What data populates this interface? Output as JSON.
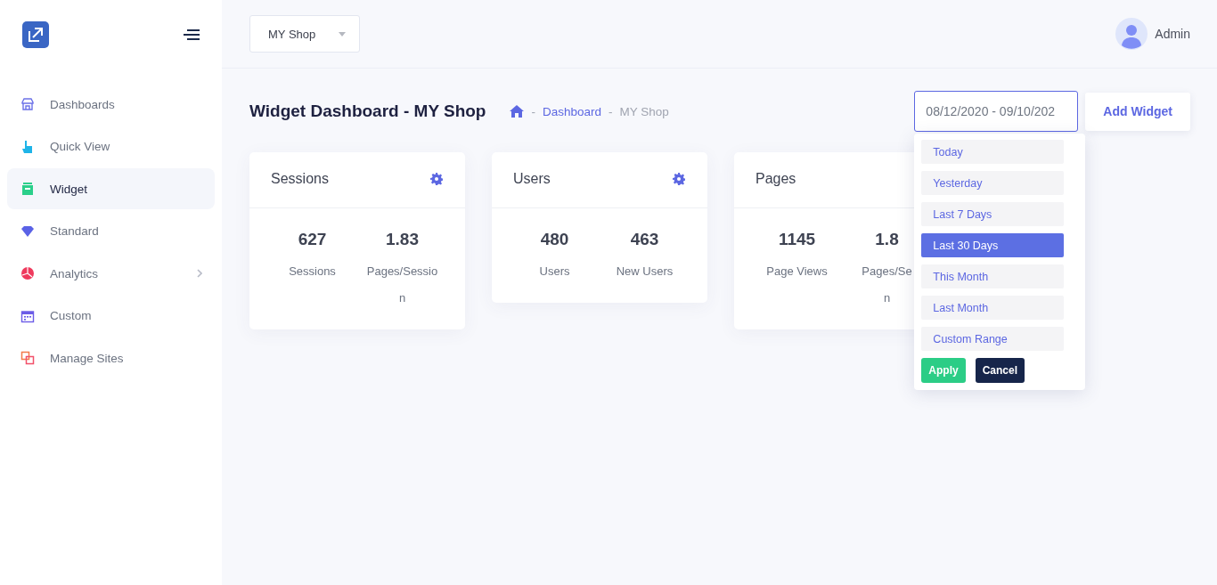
{
  "header": {
    "shop_select": "MY Shop",
    "user": "Admin"
  },
  "sidebar": {
    "items": [
      {
        "label": "Dashboards",
        "kind": "store",
        "selected": false
      },
      {
        "label": "Quick View",
        "kind": "hand",
        "selected": false
      },
      {
        "label": "Widget",
        "kind": "box",
        "selected": true
      },
      {
        "label": "Standard",
        "kind": "gem",
        "selected": false
      },
      {
        "label": "Analytics",
        "kind": "pie",
        "selected": false,
        "has_children": true
      },
      {
        "label": "Custom",
        "kind": "calendar",
        "selected": false
      },
      {
        "label": "Manage Sites",
        "kind": "squares",
        "selected": false
      }
    ]
  },
  "page": {
    "title": "Widget Dashboard - MY Shop",
    "breadcrumb": [
      {
        "separator": "-",
        "label": "Dashboard"
      },
      {
        "separator": "-",
        "label": "MY Shop"
      }
    ]
  },
  "date_range": {
    "value": "08/12/2020 - 09/10/202",
    "options": [
      {
        "label": "Today",
        "selected": false
      },
      {
        "label": "Yesterday",
        "selected": false
      },
      {
        "label": "Last 7 Days",
        "selected": false
      },
      {
        "label": "Last 30 Days",
        "selected": true
      },
      {
        "label": "This Month",
        "selected": false
      },
      {
        "label": "Last Month",
        "selected": false
      },
      {
        "label": "Custom Range",
        "selected": false
      }
    ],
    "apply": "Apply",
    "cancel": "Cancel"
  },
  "add_widget": "Add Widget",
  "widgets": [
    {
      "title": "Sessions",
      "settings": true,
      "stats": [
        {
          "value": "627",
          "label": [
            "Sessions"
          ]
        },
        {
          "value": "1.83",
          "label": [
            "Pages/Sessio",
            "n"
          ]
        }
      ]
    },
    {
      "title": "Users",
      "settings": true,
      "stats": [
        {
          "value": "480",
          "label": [
            "Users"
          ]
        },
        {
          "value": "463",
          "label": [
            "New Users"
          ]
        }
      ]
    },
    {
      "title": "Pages",
      "settings": false,
      "stats": [
        {
          "value": "1145",
          "label": [
            "Page Views"
          ]
        },
        {
          "value": "1.8",
          "label": [
            "Pages/Se",
            "n"
          ]
        }
      ]
    }
  ]
}
